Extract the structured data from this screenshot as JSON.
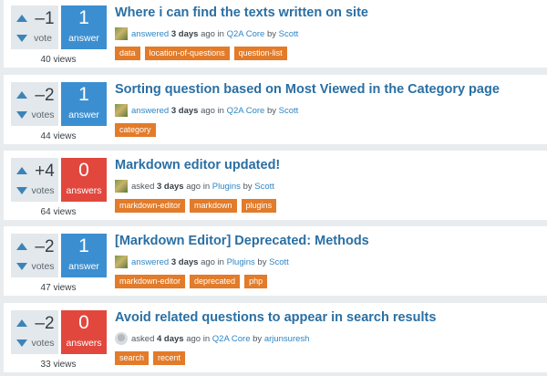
{
  "questions": [
    {
      "votes": "–1",
      "votes_label": "vote",
      "answers": "1",
      "answers_label": "answer",
      "answers_color": "#3b8fd1",
      "views": "40 views",
      "title": "Where i can find the texts written on site",
      "action": "answered",
      "when": "3 days",
      "ago": "ago",
      "in": "in",
      "category": "Q2A Core",
      "by": "by",
      "user": "Scott",
      "avatar": "user-avatar",
      "tags": [
        "data",
        "location-of-questions",
        "question-list"
      ]
    },
    {
      "votes": "–2",
      "votes_label": "votes",
      "answers": "1",
      "answers_label": "answer",
      "answers_color": "#3b8fd1",
      "views": "44 views",
      "title": "Sorting question based on Most Viewed in the Category page",
      "action": "answered",
      "when": "3 days",
      "ago": "ago",
      "in": "in",
      "category": "Q2A Core",
      "by": "by",
      "user": "Scott",
      "avatar": "user-avatar",
      "tags": [
        "category"
      ]
    },
    {
      "votes": "+4",
      "votes_label": "votes",
      "answers": "0",
      "answers_label": "answers",
      "answers_color": "#e2473e",
      "views": "64 views",
      "title": "Markdown editor updated!",
      "action": "asked",
      "when": "3 days",
      "ago": "ago",
      "in": "in",
      "category": "Plugins",
      "by": "by",
      "user": "Scott",
      "avatar": "user-avatar",
      "tags": [
        "markdown-editor",
        "markdown",
        "plugins"
      ]
    },
    {
      "votes": "–2",
      "votes_label": "votes",
      "answers": "1",
      "answers_label": "answer",
      "answers_color": "#3b8fd1",
      "views": "47 views",
      "title": "[Markdown Editor] Deprecated: Methods",
      "action": "answered",
      "when": "3 days",
      "ago": "ago",
      "in": "in",
      "category": "Plugins",
      "by": "by",
      "user": "Scott",
      "avatar": "user-avatar",
      "tags": [
        "markdown-editor",
        "deprecated",
        "php"
      ]
    },
    {
      "votes": "–2",
      "votes_label": "votes",
      "answers": "0",
      "answers_label": "answers",
      "answers_color": "#e2473e",
      "views": "33 views",
      "title": "Avoid related questions to appear in search results",
      "action": "asked",
      "when": "4 days",
      "ago": "ago",
      "in": "in",
      "category": "Q2A Core",
      "by": "by",
      "user": "arjunsuresh",
      "avatar": "default-avatar",
      "tags": [
        "search",
        "recent"
      ]
    }
  ],
  "colors": {
    "vote_arrow": "#3b84b8",
    "title": "#2a6fa3",
    "link": "#2f86c5",
    "tag": "#e27b2a",
    "answered": "#3b8fd1",
    "unanswered": "#e2473e"
  }
}
